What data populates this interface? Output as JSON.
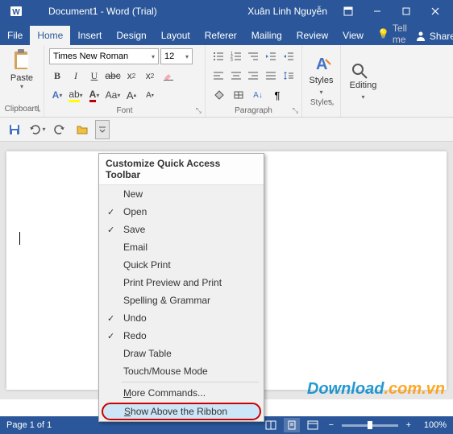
{
  "titlebar": {
    "title": "Document1 - Word (Trial)",
    "user": "Xuân Linh Nguyễn"
  },
  "tabs": {
    "file": "File",
    "home": "Home",
    "insert": "Insert",
    "design": "Design",
    "layout": "Layout",
    "references": "Referer",
    "mailings": "Mailing",
    "review": "Review",
    "view": "View",
    "tellme": "Tell me",
    "share": "Share"
  },
  "ribbon": {
    "clipboard": {
      "label": "Clipboard",
      "paste": "Paste"
    },
    "font": {
      "label": "Font",
      "name": "Times New Roman",
      "size": "12"
    },
    "paragraph": {
      "label": "Paragraph"
    },
    "styles": {
      "label": "Styles"
    },
    "editing": {
      "label": "Editing"
    }
  },
  "dropdown": {
    "header": "Customize Quick Access Toolbar",
    "items": [
      {
        "label": "New",
        "checked": false
      },
      {
        "label": "Open",
        "checked": true
      },
      {
        "label": "Save",
        "checked": true
      },
      {
        "label": "Email",
        "checked": false
      },
      {
        "label": "Quick Print",
        "checked": false
      },
      {
        "label": "Print Preview and Print",
        "checked": false
      },
      {
        "label": "Spelling & Grammar",
        "checked": false
      },
      {
        "label": "Undo",
        "checked": true
      },
      {
        "label": "Redo",
        "checked": true
      },
      {
        "label": "Draw Table",
        "checked": false
      },
      {
        "label": "Touch/Mouse Mode",
        "checked": false
      }
    ],
    "more": "More Commands...",
    "show": "Show Above the Ribbon"
  },
  "statusbar": {
    "page": "Page 1 of 1",
    "zoom": "100%"
  },
  "watermark": {
    "main": "Download",
    "suffix": ".com.vn"
  }
}
